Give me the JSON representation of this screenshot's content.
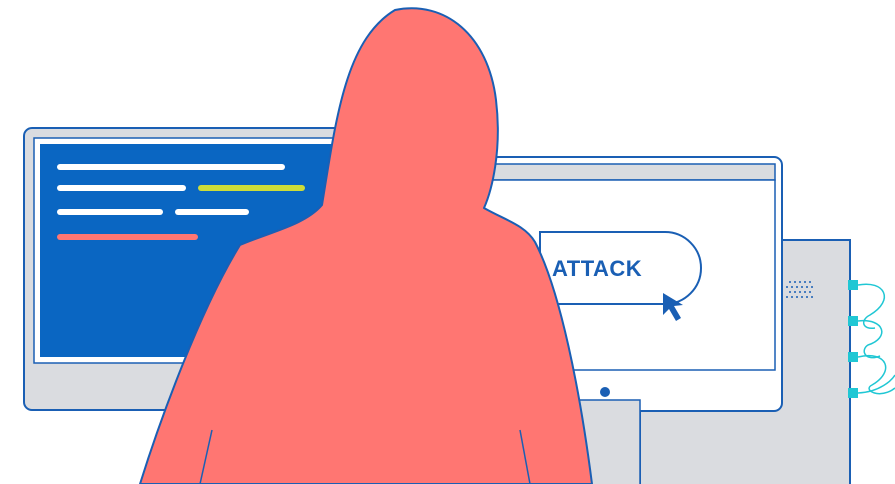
{
  "illustration": {
    "attack_button_label": "ATTACK",
    "icons": {
      "cursor": "mouse-pointer-icon",
      "hacker": "hooded-figure"
    },
    "colors": {
      "outline": "#1a5fb4",
      "screen_blue": "#0a66c2",
      "monitor_gray": "#dadce0",
      "hacker_fill": "#ff7672",
      "code_white": "#ffffff",
      "code_yellow": "#cddc39",
      "code_red": "#ff7672",
      "cable": "#20c7d4"
    }
  }
}
